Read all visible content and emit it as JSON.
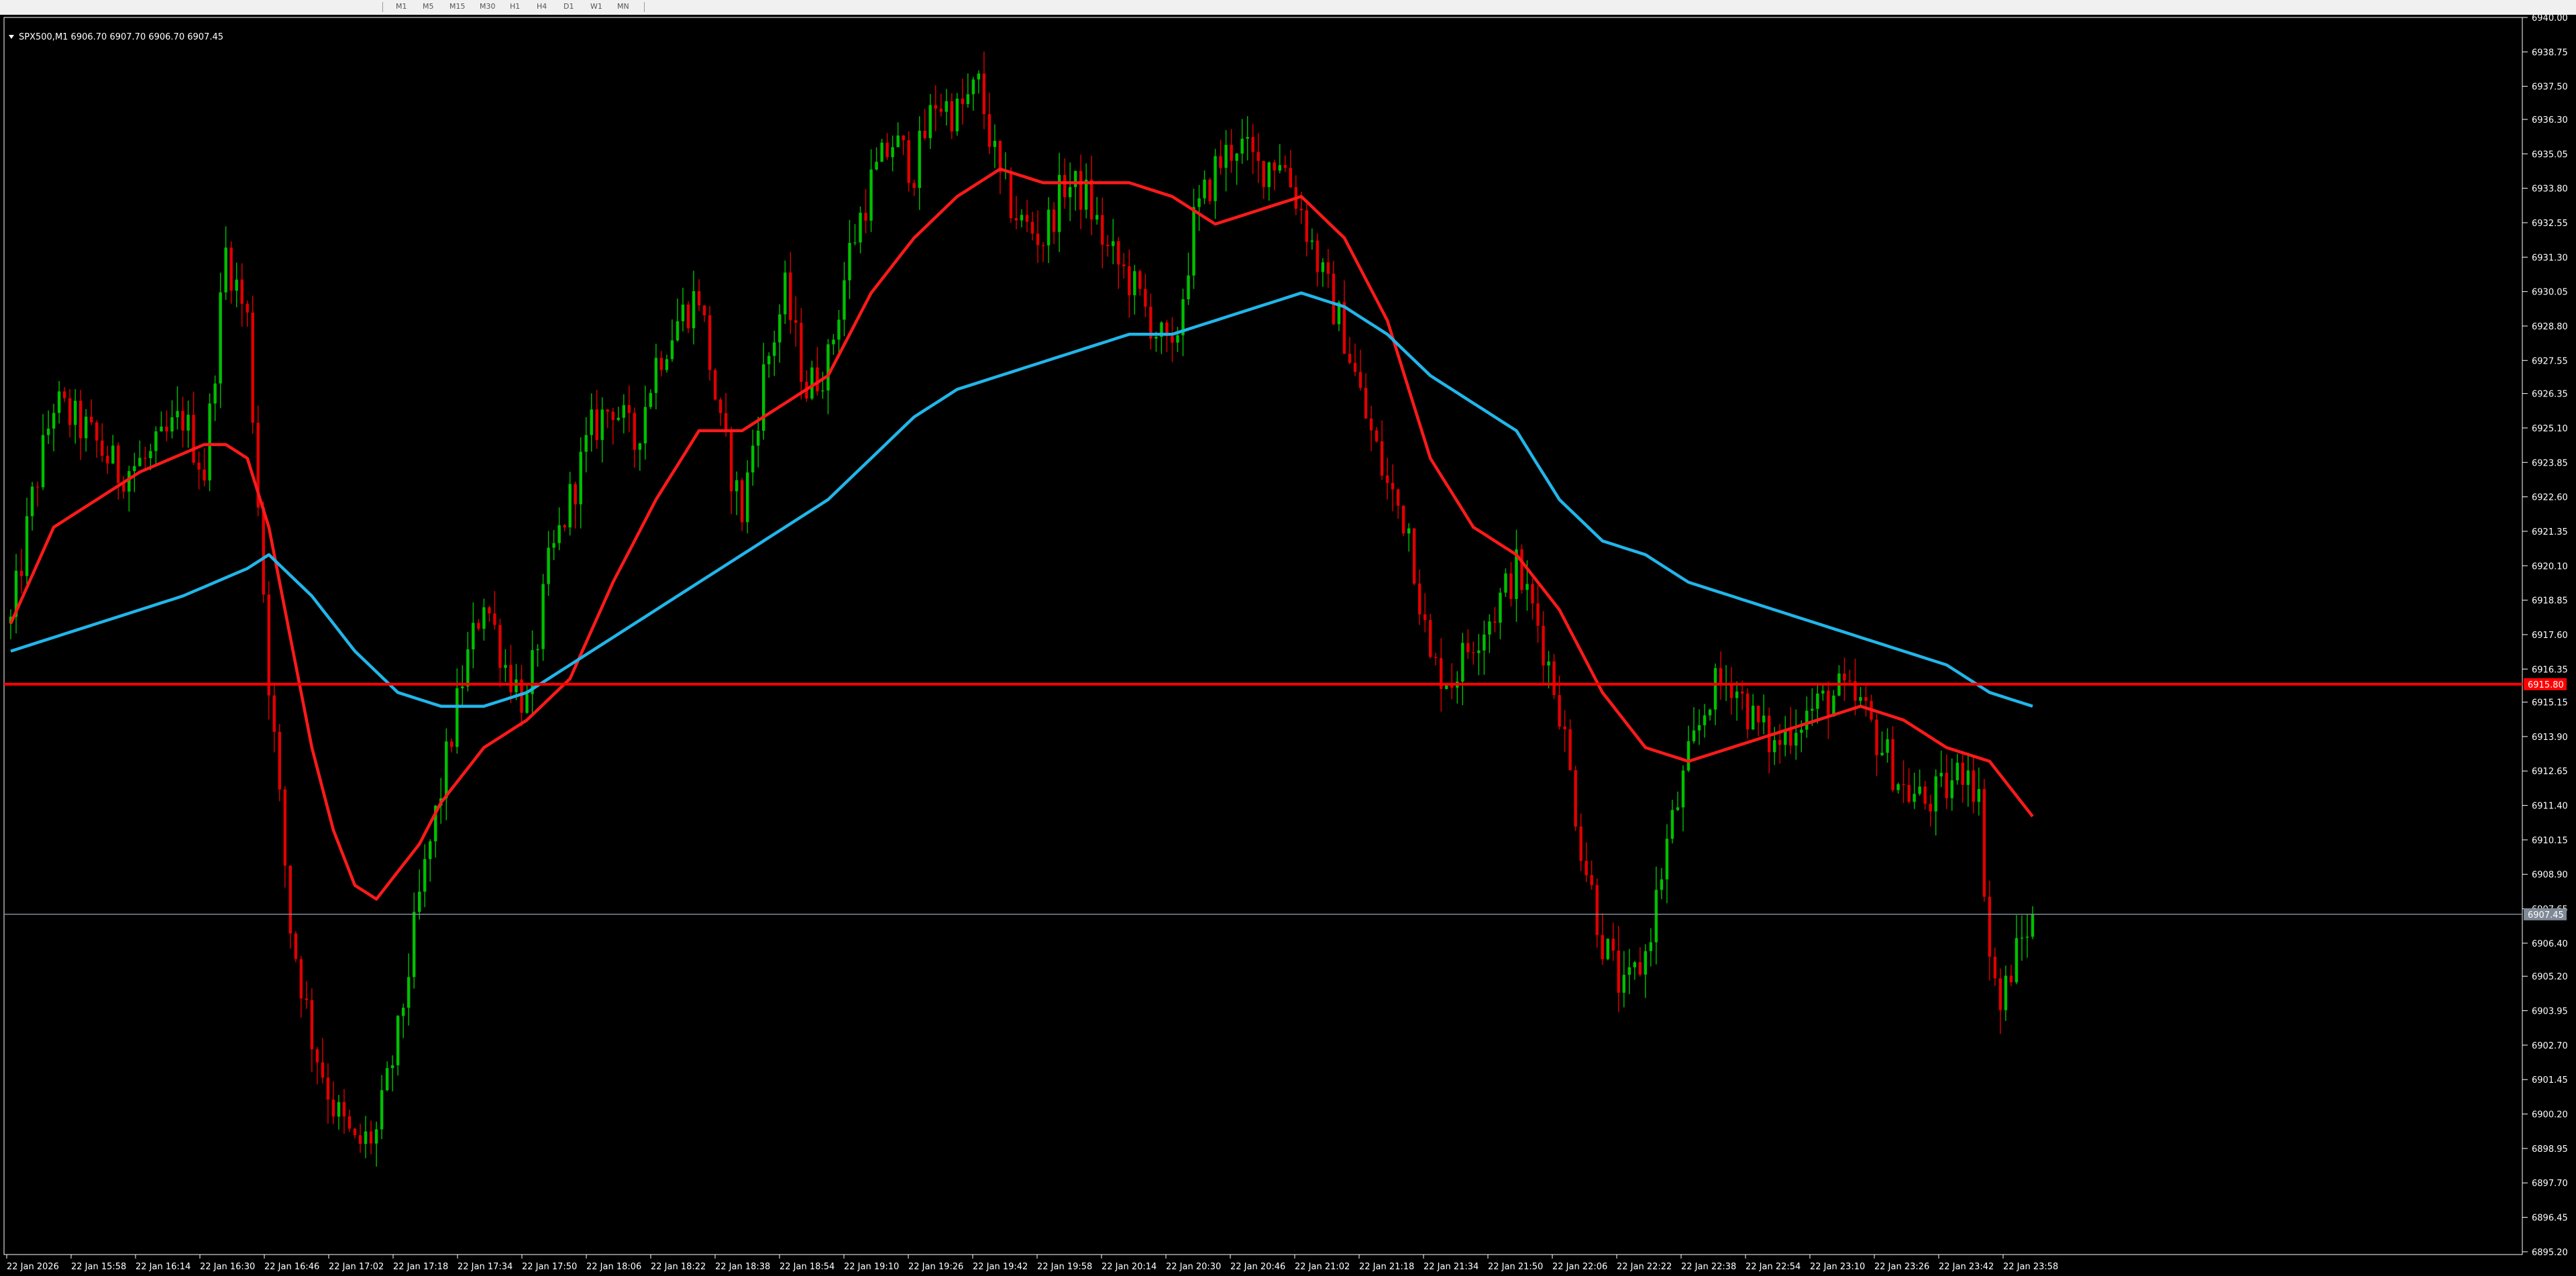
{
  "toolbar": {
    "timeframes": [
      "M1",
      "M5",
      "M15",
      "M30",
      "H1",
      "H4",
      "D1",
      "W1",
      "MN"
    ]
  },
  "chart_data": {
    "type": "candlestick",
    "title": "SPX500,M1  6906.70 6907.70 6906.70 6907.45",
    "symbol": "SPX500",
    "timeframe": "M1",
    "ohlc_header": {
      "open": 6906.7,
      "high": 6907.7,
      "low": 6906.7,
      "close": 6907.45
    },
    "colors": {
      "background": "#000000",
      "bull_candle": "#00c000",
      "bear_candle": "#e00000",
      "fast_ma": "#ff1a1a",
      "slow_ma": "#21b6ea",
      "level_line": "#ff0000",
      "bid_line": "#7f8a96",
      "axis": "#ffffff",
      "text": "#ffffff"
    },
    "ylim": [
      6895.1,
      6940.0
    ],
    "y_ticks": [
      "6940.00",
      "6938.75",
      "6937.50",
      "6936.30",
      "6935.05",
      "6933.80",
      "6932.55",
      "6931.30",
      "6930.05",
      "6928.80",
      "6927.55",
      "6926.35",
      "6925.10",
      "6923.85",
      "6922.60",
      "6921.35",
      "6920.10",
      "6918.85",
      "6917.60",
      "6916.35",
      "6915.15",
      "6913.90",
      "6912.65",
      "6911.40",
      "6910.15",
      "6908.90",
      "6907.65",
      "6906.40",
      "6905.20",
      "6903.95",
      "6902.70",
      "6901.45",
      "6900.20",
      "6898.95",
      "6897.70",
      "6896.45",
      "6895.20"
    ],
    "x_ticks": [
      "22 Jan 2026",
      "22 Jan 15:58",
      "22 Jan 16:14",
      "22 Jan 16:30",
      "22 Jan 16:46",
      "22 Jan 17:02",
      "22 Jan 17:18",
      "22 Jan 17:34",
      "22 Jan 17:50",
      "22 Jan 18:06",
      "22 Jan 18:22",
      "22 Jan 18:38",
      "22 Jan 18:54",
      "22 Jan 19:10",
      "22 Jan 19:26",
      "22 Jan 19:42",
      "22 Jan 19:58",
      "22 Jan 20:14",
      "22 Jan 20:30",
      "22 Jan 20:46",
      "22 Jan 21:02",
      "22 Jan 21:18",
      "22 Jan 21:34",
      "22 Jan 21:50",
      "22 Jan 22:06",
      "22 Jan 22:22",
      "22 Jan 22:38",
      "22 Jan 22:54",
      "22 Jan 23:10",
      "22 Jan 23:26",
      "22 Jan 23:42",
      "22 Jan 23:58"
    ],
    "horizontal_level": {
      "price": 6915.8,
      "label": "6915.80"
    },
    "bid_line": {
      "price": 6907.45,
      "label": "6907.45"
    },
    "price_path": [
      [
        0,
        6918.0
      ],
      [
        4,
        6922.5
      ],
      [
        8,
        6926.0
      ],
      [
        14,
        6925.0
      ],
      [
        20,
        6923.5
      ],
      [
        26,
        6924.0
      ],
      [
        32,
        6925.5
      ],
      [
        36,
        6923.5
      ],
      [
        40,
        6931.5
      ],
      [
        44,
        6929.0
      ],
      [
        48,
        6916.0
      ],
      [
        52,
        6907.0
      ],
      [
        56,
        6903.0
      ],
      [
        60,
        6900.5
      ],
      [
        64,
        6899.0
      ],
      [
        68,
        6899.5
      ],
      [
        72,
        6903.0
      ],
      [
        76,
        6908.0
      ],
      [
        80,
        6912.0
      ],
      [
        84,
        6916.0
      ],
      [
        88,
        6919.0
      ],
      [
        92,
        6916.5
      ],
      [
        96,
        6915.0
      ],
      [
        100,
        6920.0
      ],
      [
        104,
        6922.5
      ],
      [
        108,
        6925.0
      ],
      [
        112,
        6926.0
      ],
      [
        116,
        6924.5
      ],
      [
        120,
        6927.5
      ],
      [
        124,
        6929.0
      ],
      [
        128,
        6930.0
      ],
      [
        132,
        6925.0
      ],
      [
        136,
        6922.0
      ],
      [
        140,
        6927.0
      ],
      [
        144,
        6930.0
      ],
      [
        148,
        6926.5
      ],
      [
        152,
        6927.5
      ],
      [
        156,
        6931.5
      ],
      [
        160,
        6934.0
      ],
      [
        164,
        6935.5
      ],
      [
        168,
        6934.5
      ],
      [
        172,
        6937.0
      ],
      [
        176,
        6936.5
      ],
      [
        180,
        6937.5
      ],
      [
        184,
        6934.0
      ],
      [
        188,
        6932.5
      ],
      [
        192,
        6932.0
      ],
      [
        196,
        6934.0
      ],
      [
        200,
        6933.5
      ],
      [
        204,
        6931.5
      ],
      [
        208,
        6930.5
      ],
      [
        212,
        6929.0
      ],
      [
        216,
        6927.5
      ],
      [
        220,
        6932.5
      ],
      [
        224,
        6934.5
      ],
      [
        228,
        6935.5
      ],
      [
        232,
        6934.5
      ],
      [
        236,
        6935.0
      ],
      [
        240,
        6933.0
      ],
      [
        244,
        6930.5
      ],
      [
        248,
        6928.5
      ],
      [
        252,
        6925.5
      ],
      [
        256,
        6923.0
      ],
      [
        260,
        6921.5
      ],
      [
        264,
        6916.5
      ],
      [
        268,
        6916.0
      ],
      [
        272,
        6917.5
      ],
      [
        276,
        6918.5
      ],
      [
        280,
        6920.0
      ],
      [
        284,
        6918.0
      ],
      [
        288,
        6915.0
      ],
      [
        292,
        6910.0
      ],
      [
        296,
        6906.5
      ],
      [
        300,
        6904.5
      ],
      [
        304,
        6906.0
      ],
      [
        308,
        6910.0
      ],
      [
        312,
        6913.0
      ],
      [
        316,
        6915.5
      ],
      [
        320,
        6916.0
      ],
      [
        324,
        6914.5
      ],
      [
        328,
        6913.5
      ],
      [
        332,
        6914.5
      ],
      [
        336,
        6915.0
      ],
      [
        340,
        6915.5
      ],
      [
        344,
        6915.0
      ],
      [
        348,
        6913.5
      ],
      [
        352,
        6912.0
      ],
      [
        356,
        6911.5
      ],
      [
        360,
        6912.0
      ],
      [
        364,
        6913.0
      ],
      [
        366,
        6911.5
      ],
      [
        368,
        6906.0
      ],
      [
        370,
        6904.0
      ],
      [
        372,
        6905.5
      ],
      [
        374,
        6906.5
      ],
      [
        376,
        6907.45
      ]
    ],
    "indicators": [
      {
        "type": "moving_average",
        "color_key": "fast_ma",
        "points": [
          [
            0,
            6918.0
          ],
          [
            8,
            6921.5
          ],
          [
            16,
            6922.5
          ],
          [
            24,
            6923.5
          ],
          [
            36,
            6924.5
          ],
          [
            40,
            6924.5
          ],
          [
            44,
            6924.0
          ],
          [
            48,
            6921.5
          ],
          [
            52,
            6917.5
          ],
          [
            56,
            6913.5
          ],
          [
            60,
            6910.5
          ],
          [
            64,
            6908.5
          ],
          [
            68,
            6908.0
          ],
          [
            72,
            6909.0
          ],
          [
            76,
            6910.0
          ],
          [
            80,
            6911.5
          ],
          [
            88,
            6913.5
          ],
          [
            96,
            6914.5
          ],
          [
            104,
            6916.0
          ],
          [
            112,
            6919.5
          ],
          [
            120,
            6922.5
          ],
          [
            128,
            6925.0
          ],
          [
            136,
            6925.0
          ],
          [
            144,
            6926.0
          ],
          [
            152,
            6927.0
          ],
          [
            160,
            6930.0
          ],
          [
            168,
            6932.0
          ],
          [
            176,
            6933.5
          ],
          [
            184,
            6934.5
          ],
          [
            192,
            6934.0
          ],
          [
            200,
            6934.0
          ],
          [
            208,
            6934.0
          ],
          [
            216,
            6933.5
          ],
          [
            224,
            6932.5
          ],
          [
            232,
            6933.0
          ],
          [
            240,
            6933.5
          ],
          [
            248,
            6932.0
          ],
          [
            256,
            6929.0
          ],
          [
            264,
            6924.0
          ],
          [
            272,
            6921.5
          ],
          [
            280,
            6920.5
          ],
          [
            288,
            6918.5
          ],
          [
            296,
            6915.5
          ],
          [
            304,
            6913.5
          ],
          [
            312,
            6913.0
          ],
          [
            320,
            6913.5
          ],
          [
            328,
            6914.0
          ],
          [
            336,
            6914.5
          ],
          [
            344,
            6915.0
          ],
          [
            352,
            6914.5
          ],
          [
            360,
            6913.5
          ],
          [
            368,
            6913.0
          ],
          [
            372,
            6912.0
          ],
          [
            376,
            6911.0
          ]
        ]
      },
      {
        "type": "moving_average",
        "color_key": "slow_ma",
        "points": [
          [
            0,
            6917.0
          ],
          [
            16,
            6918.0
          ],
          [
            32,
            6919.0
          ],
          [
            44,
            6920.0
          ],
          [
            48,
            6920.5
          ],
          [
            56,
            6919.0
          ],
          [
            64,
            6917.0
          ],
          [
            72,
            6915.5
          ],
          [
            80,
            6915.0
          ],
          [
            88,
            6915.0
          ],
          [
            96,
            6915.5
          ],
          [
            104,
            6916.5
          ],
          [
            112,
            6917.5
          ],
          [
            120,
            6918.5
          ],
          [
            128,
            6919.5
          ],
          [
            136,
            6920.5
          ],
          [
            144,
            6921.5
          ],
          [
            152,
            6922.5
          ],
          [
            160,
            6924.0
          ],
          [
            168,
            6925.5
          ],
          [
            176,
            6926.5
          ],
          [
            184,
            6927.0
          ],
          [
            192,
            6927.5
          ],
          [
            200,
            6928.0
          ],
          [
            208,
            6928.5
          ],
          [
            216,
            6928.5
          ],
          [
            224,
            6929.0
          ],
          [
            232,
            6929.5
          ],
          [
            240,
            6930.0
          ],
          [
            248,
            6929.5
          ],
          [
            256,
            6928.5
          ],
          [
            264,
            6927.0
          ],
          [
            272,
            6926.0
          ],
          [
            280,
            6925.0
          ],
          [
            288,
            6922.5
          ],
          [
            296,
            6921.0
          ],
          [
            304,
            6920.5
          ],
          [
            312,
            6919.5
          ],
          [
            320,
            6919.0
          ],
          [
            328,
            6918.5
          ],
          [
            336,
            6918.0
          ],
          [
            344,
            6917.5
          ],
          [
            352,
            6917.0
          ],
          [
            360,
            6916.5
          ],
          [
            368,
            6915.5
          ],
          [
            376,
            6915.0
          ]
        ]
      }
    ]
  }
}
